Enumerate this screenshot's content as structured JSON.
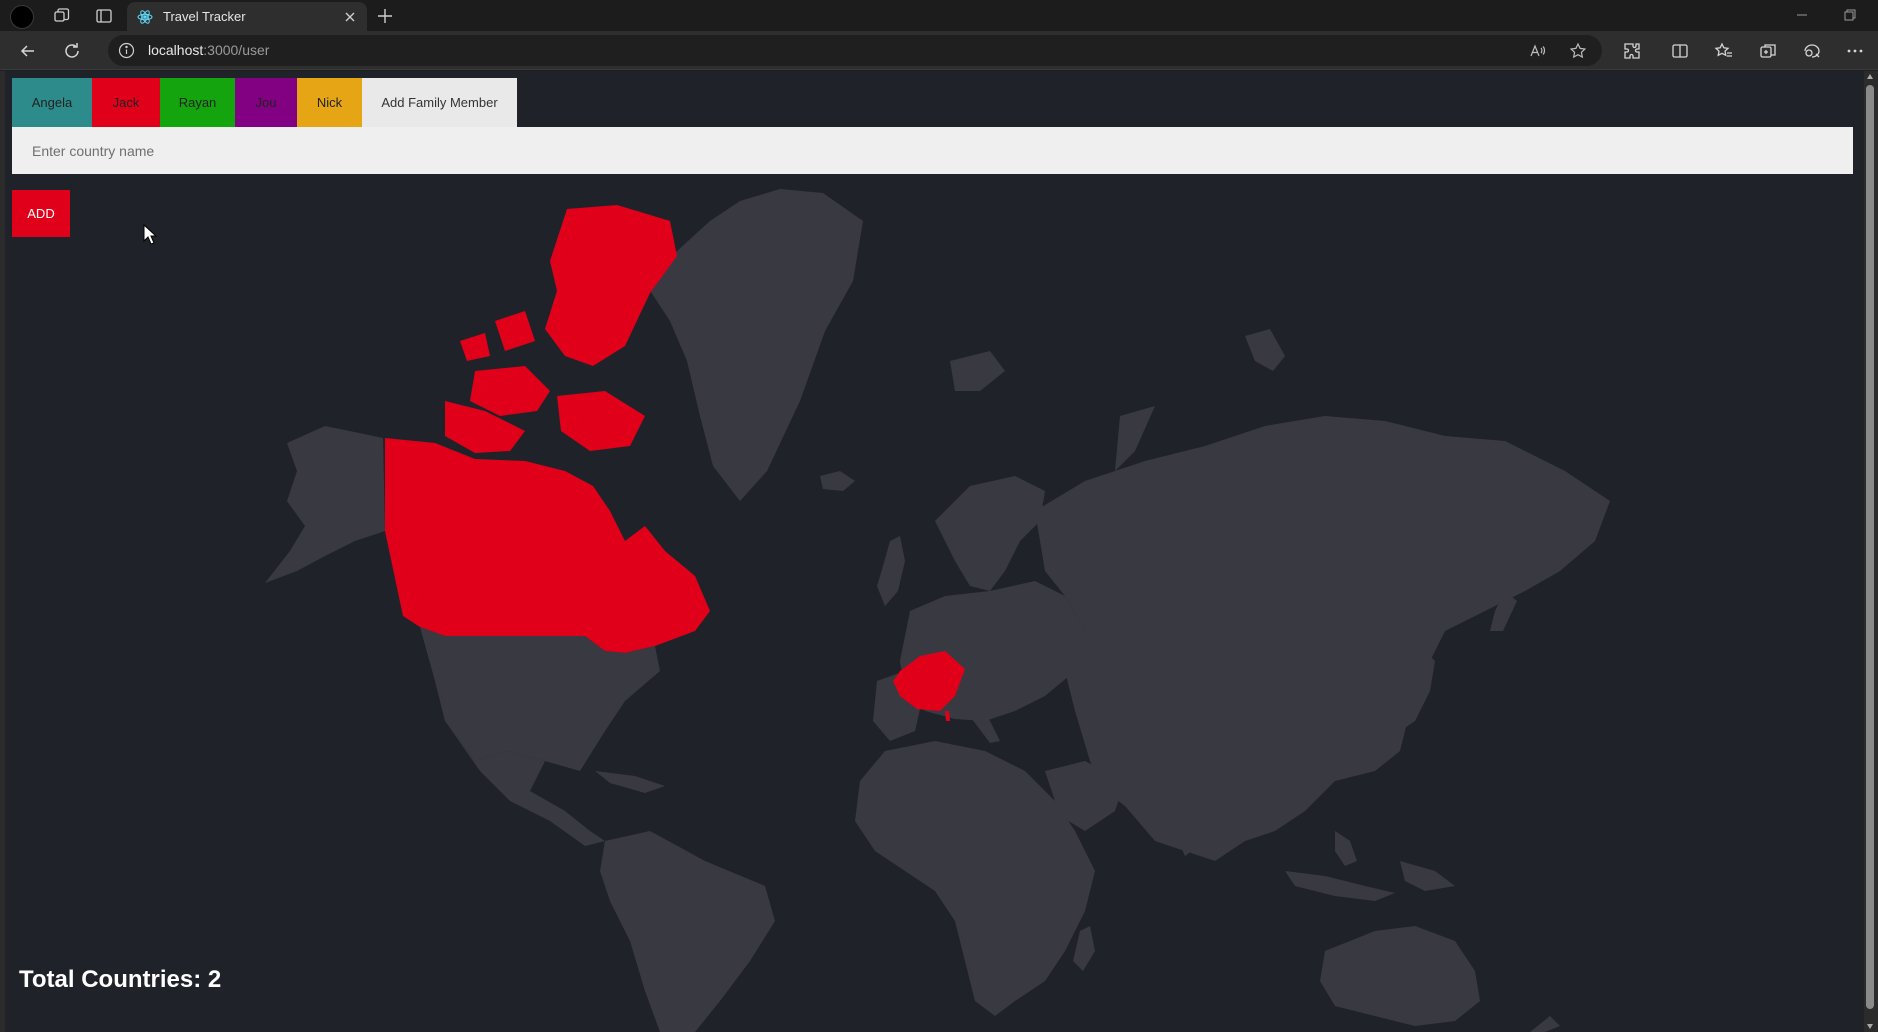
{
  "browser": {
    "tab_title": "Travel Tracker",
    "url_host": "localhost",
    "url_rest": ":3000/user"
  },
  "family": {
    "members": [
      {
        "name": "Angela",
        "color": "#2e8b8b"
      },
      {
        "name": "Jack",
        "color": "#e1001a"
      },
      {
        "name": "Rayan",
        "color": "#14a40e"
      },
      {
        "name": "Jou",
        "color": "#820082"
      },
      {
        "name": "Nick",
        "color": "#e6a514"
      }
    ],
    "add_member_label": "Add Family Member"
  },
  "form": {
    "placeholder": "Enter country name",
    "add_button_label": "ADD"
  },
  "map": {
    "base_color": "#393941",
    "visited_color": "#e1001a",
    "visited_countries": [
      "Canada",
      "France"
    ]
  },
  "total": {
    "text": "Total Countries: 2"
  }
}
